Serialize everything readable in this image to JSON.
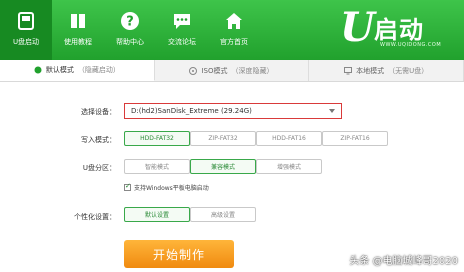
{
  "nav": {
    "items": [
      {
        "label": "U盘启动",
        "icon": "usb-drive-icon"
      },
      {
        "label": "使用教程",
        "icon": "book-icon"
      },
      {
        "label": "帮助中心",
        "icon": "help-icon"
      },
      {
        "label": "交流论坛",
        "icon": "forum-icon"
      },
      {
        "label": "官方首页",
        "icon": "home-icon"
      }
    ],
    "active_index": 0
  },
  "logo": {
    "letter": "U",
    "text": "启动",
    "url": "WWW.UQIDONG.COM"
  },
  "tabs": [
    {
      "label": "默认模式",
      "sub": "（隐藏启动）"
    },
    {
      "label": "ISO模式",
      "sub": "（深度隐藏）"
    },
    {
      "label": "本地模式",
      "sub": "（无需U盘）"
    }
  ],
  "form": {
    "device_label": "选择设备：",
    "device_value": "D:(hd2)SanDisk_Extreme (29.24G)",
    "write_mode_label": "写入模式：",
    "write_modes": [
      "HDD-FAT32",
      "ZIP-FAT32",
      "HDD-FAT16",
      "ZIP-FAT16"
    ],
    "partition_label": "U盘分区：",
    "partition_modes": [
      "智能模式",
      "兼容模式",
      "增强模式"
    ],
    "support_label": "支持Windows平板电脑启动",
    "personal_label": "个性化设置：",
    "personal_options": [
      "默认设置",
      "高级设置"
    ],
    "start_label": "开始制作"
  },
  "watermark": "头条 @电脑城峰哥2020",
  "colors": {
    "brand_green": "#21a12d",
    "start_orange": "#f08a10",
    "highlight_red": "#d93a3a"
  }
}
